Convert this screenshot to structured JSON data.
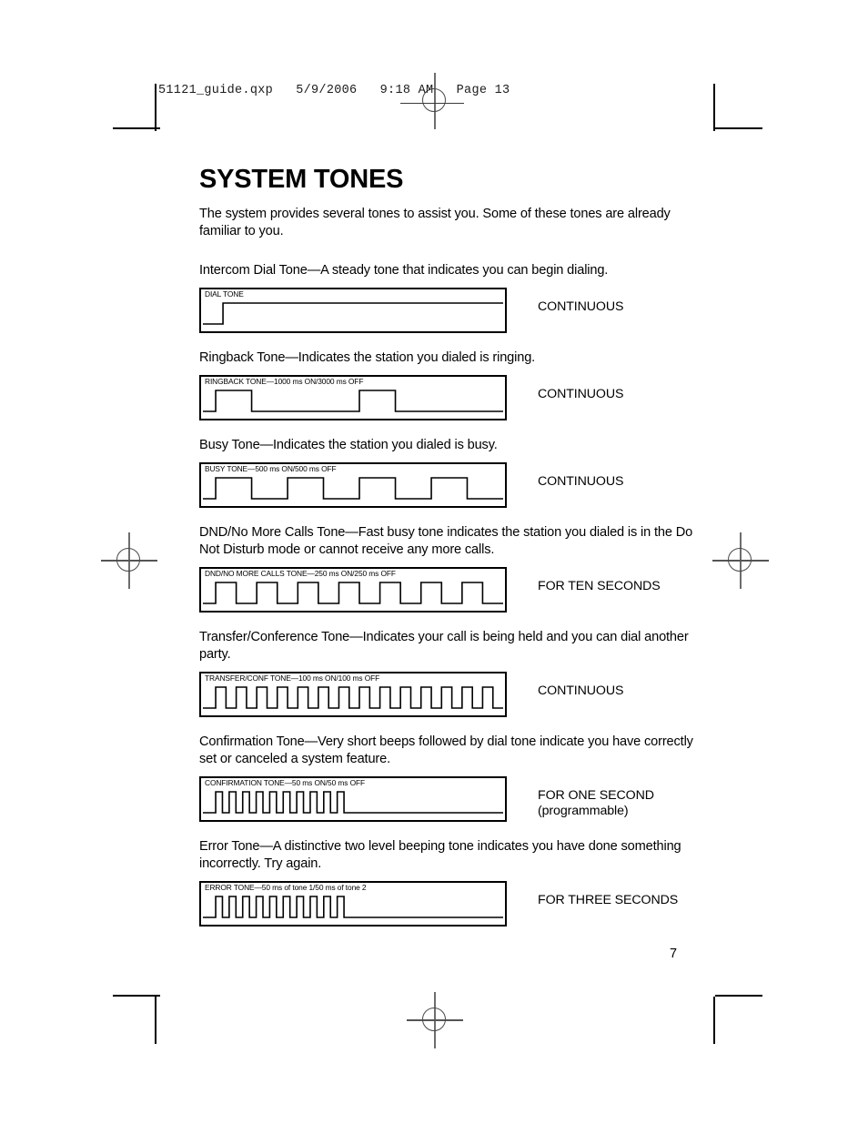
{
  "slug": {
    "text": "51121_guide.qxp   5/9/2006   9:18 AM   Page 13"
  },
  "header": {
    "title": "SYSTEM TONES"
  },
  "intro": {
    "paragraph": "The system provides several tones to assist you. Some of these tones are already familiar to you."
  },
  "tones": [
    {
      "description": "Intercom Dial Tone—A steady tone that indicates you can begin dialing.",
      "box_label": "DIAL TONE",
      "duration": "CONTINUOUS",
      "waveform": {
        "kind": "step",
        "on_ms": null,
        "off_ms": null,
        "pulses": 1
      }
    },
    {
      "description": "Ringback Tone—Indicates the station you dialed is ringing.",
      "box_label": "RINGBACK TONE—1000 ms ON/3000 ms OFF",
      "duration": "CONTINUOUS",
      "waveform": {
        "kind": "pulse",
        "on_ms": 1000,
        "off_ms": 3000,
        "pulses": 2
      }
    },
    {
      "description": "Busy Tone—Indicates the station you dialed is busy.",
      "box_label": "BUSY TONE—500 ms ON/500 ms OFF",
      "duration": "CONTINUOUS",
      "waveform": {
        "kind": "pulse",
        "on_ms": 500,
        "off_ms": 500,
        "pulses": 4
      }
    },
    {
      "description": "DND/No More Calls Tone—Fast busy tone indicates the station you dialed is in the Do Not Disturb mode or cannot receive any more calls.",
      "box_label": "DND/NO MORE CALLS TONE—250 ms ON/250 ms OFF",
      "duration": "FOR TEN SECONDS",
      "waveform": {
        "kind": "pulse",
        "on_ms": 250,
        "off_ms": 250,
        "pulses": 7
      }
    },
    {
      "description": "Transfer/Conference Tone—Indicates your call is being held and you can dial another party.",
      "box_label": "TRANSFER/CONF TONE—100 ms ON/100 ms OFF",
      "duration": "CONTINUOUS",
      "waveform": {
        "kind": "pulse",
        "on_ms": 100,
        "off_ms": 100,
        "pulses": 14
      }
    },
    {
      "description": "Confirmation Tone—Very short beeps followed by dial tone indicate you have correctly set or canceled a system feature.",
      "box_label": "CONFIRMATION TONE—50 ms ON/50 ms OFF",
      "duration": "FOR ONE SECOND\n(programmable)",
      "waveform": {
        "kind": "burst",
        "on_ms": 50,
        "off_ms": 50,
        "pulses": 10
      }
    },
    {
      "description": "Error Tone—A distinctive two level beeping tone indicates you have done something incorrectly. Try again.",
      "box_label": "ERROR TONE—50 ms of tone 1/50 ms of tone 2",
      "duration": "FOR THREE  SECONDS",
      "waveform": {
        "kind": "burst",
        "on_ms": 50,
        "off_ms": 50,
        "pulses": 10
      }
    }
  ],
  "footer": {
    "page_number": "7"
  },
  "colors": {
    "ink": "#000000",
    "paper": "#ffffff",
    "registration_mark": "#555555"
  }
}
